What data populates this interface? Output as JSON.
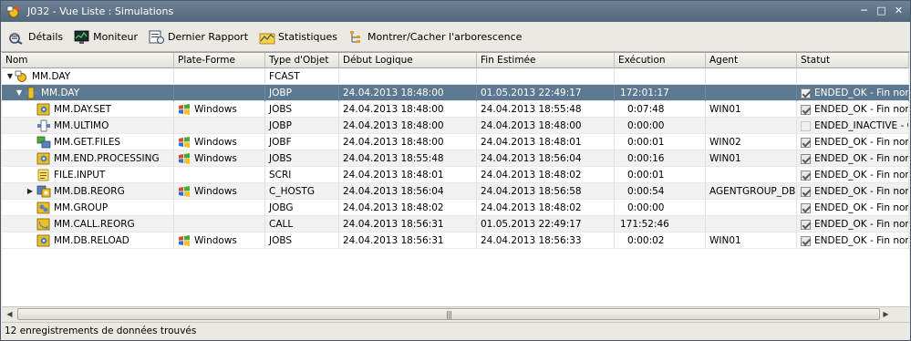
{
  "window": {
    "title": "J032 - Vue Liste : Simulations"
  },
  "toolbar": {
    "details": "Détails",
    "moniteur": "Moniteur",
    "dernier_rapport": "Dernier Rapport",
    "statistiques": "Statistiques",
    "montrer_cacher": "Montrer/Cacher l'arborescence"
  },
  "columns": [
    "Nom",
    "Plate-Forme",
    "Type d'Objet",
    "Début Logique",
    "Fin Estimée",
    "Exécution",
    "Agent",
    "Statut"
  ],
  "rows": [
    {
      "nom": "MM.DAY",
      "plateforme": "",
      "type": "FCAST",
      "debut": "",
      "fin": "",
      "execution": "",
      "agent": "",
      "statut": ""
    },
    {
      "nom": "MM.DAY",
      "plateforme": "",
      "type": "JOBP",
      "debut": "24.04.2013 18:48:00",
      "fin": "01.05.2013 22:49:17",
      "execution": "172:01:17",
      "agent": "",
      "statut": "ENDED_OK - Fin norm."
    },
    {
      "nom": "MM.DAY.SET",
      "plateforme": "Windows",
      "type": "JOBS",
      "debut": "24.04.2013 18:48:00",
      "fin": "24.04.2013 18:55:48",
      "execution": "0:07:48",
      "agent": "WIN01",
      "statut": "ENDED_OK - Fin norm."
    },
    {
      "nom": "MM.ULTIMO",
      "plateforme": "",
      "type": "JOBP",
      "debut": "24.04.2013 18:48:00",
      "fin": "24.04.2013 18:48:00",
      "execution": "0:00:00",
      "agent": "",
      "statut": "ENDED_INACTIVE - C."
    },
    {
      "nom": "MM.GET.FILES",
      "plateforme": "Windows",
      "type": "JOBF",
      "debut": "24.04.2013 18:48:00",
      "fin": "24.04.2013 18:48:01",
      "execution": "0:00:01",
      "agent": "WIN02",
      "statut": "ENDED_OK - Fin norm."
    },
    {
      "nom": "MM.END.PROCESSING",
      "plateforme": "Windows",
      "type": "JOBS",
      "debut": "24.04.2013 18:55:48",
      "fin": "24.04.2013 18:56:04",
      "execution": "0:00:16",
      "agent": "WIN01",
      "statut": "ENDED_OK - Fin norm."
    },
    {
      "nom": "FILE.INPUT",
      "plateforme": "",
      "type": "SCRI",
      "debut": "24.04.2013 18:48:01",
      "fin": "24.04.2013 18:48:02",
      "execution": "0:00:01",
      "agent": "",
      "statut": "ENDED_OK - Fin norm."
    },
    {
      "nom": "MM.DB.REORG",
      "plateforme": "Windows",
      "type": "C_HOSTG",
      "debut": "24.04.2013 18:56:04",
      "fin": "24.04.2013 18:56:58",
      "execution": "0:00:54",
      "agent": "AGENTGROUP_DB",
      "statut": "ENDED_OK - Fin norm."
    },
    {
      "nom": "MM.GROUP",
      "plateforme": "",
      "type": "JOBG",
      "debut": "24.04.2013 18:48:02",
      "fin": "24.04.2013 18:48:02",
      "execution": "0:00:00",
      "agent": "",
      "statut": "ENDED_OK - Fin norm."
    },
    {
      "nom": "MM.CALL.REORG",
      "plateforme": "",
      "type": "CALL",
      "debut": "24.04.2013 18:56:31",
      "fin": "01.05.2013 22:49:17",
      "execution": "171:52:46",
      "agent": "",
      "statut": "ENDED_OK - Fin norm."
    },
    {
      "nom": "MM.DB.RELOAD",
      "plateforme": "Windows",
      "type": "JOBS",
      "debut": "24.04.2013 18:56:31",
      "fin": "24.04.2013 18:56:33",
      "execution": "0:00:02",
      "agent": "WIN01",
      "statut": "ENDED_OK - Fin norm."
    }
  ],
  "status_bar": "12 enregistrements de données trouvés"
}
